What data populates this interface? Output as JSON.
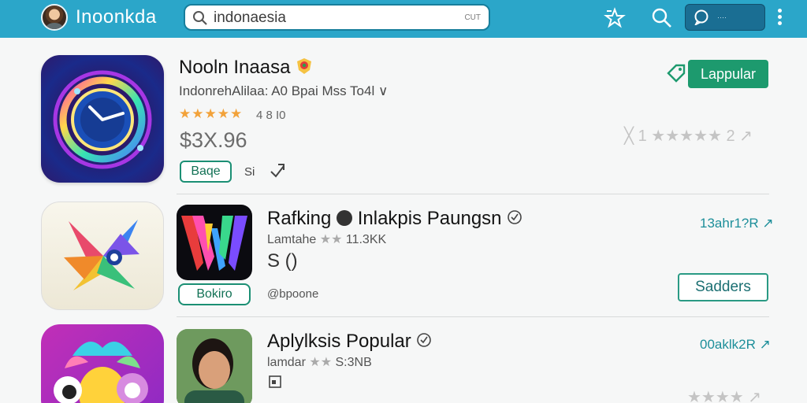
{
  "header": {
    "brand": "Inoonkda",
    "search_value": "indonaesia",
    "search_hint": "CUT",
    "chat_label": "····",
    "accent": "#2ba6c9"
  },
  "apps": [
    {
      "title": "Nooln Inaasa",
      "subtitle": "IndonrehAlilaa: A0 Bpai Mss To4l ∨",
      "stars": "★★★★★",
      "rating": "4 8 I0",
      "price": "$3X.96",
      "pill": "Baqe",
      "pill_side": "Si",
      "primary_button": "Lappular",
      "rating_row": "╳ 1 ★★★★★ 2 ↗"
    },
    {
      "title": "Rafking",
      "title_rest": "Inlakpis Paungsn",
      "subtitle": "Lamtahe",
      "subtitle_stars": "★★",
      "subtitle_count": "11.3KK",
      "price": "S ()",
      "pill": "Bokiro",
      "handle": "@bpoone",
      "rank": "13ahr1?R ↗",
      "button": "Sadders"
    },
    {
      "title": "Aplylksis Popular",
      "subtitle": "lamdar",
      "subtitle_stars": "★★",
      "subtitle_count": "S:3NB",
      "rank": "00aklk2R ↗",
      "rating_row": "★★★★ ↗"
    }
  ]
}
